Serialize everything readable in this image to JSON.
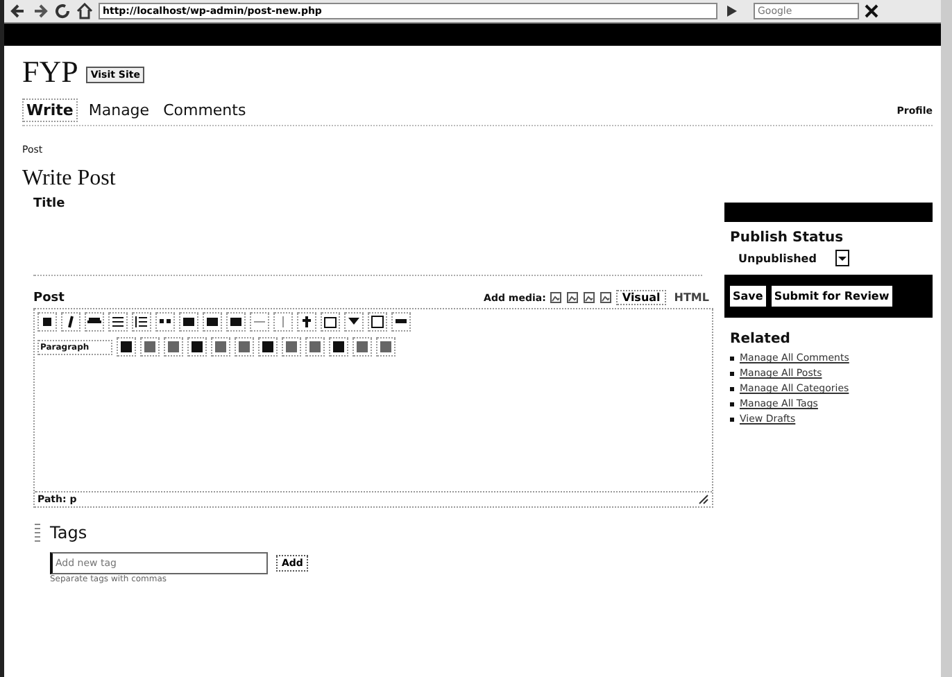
{
  "browser": {
    "url": "http://localhost/wp-admin/post-new.php",
    "search_placeholder": "Google"
  },
  "header": {
    "site_title": "FYP",
    "visit_button": "Visit Site"
  },
  "nav": {
    "items": [
      {
        "label": "Write",
        "selected": true
      },
      {
        "label": "Manage",
        "selected": false
      },
      {
        "label": "Comments",
        "selected": false
      }
    ],
    "profile": "Profile"
  },
  "subnav": {
    "items": [
      {
        "label": "Post",
        "selected": true
      }
    ]
  },
  "page_title": "Write Post",
  "title_field": {
    "label": "Title"
  },
  "editor": {
    "label": "Post",
    "add_media": "Add media:",
    "modes": [
      {
        "label": "Visual",
        "selected": true
      },
      {
        "label": "HTML",
        "selected": false
      }
    ],
    "format": "Paragraph",
    "path": "Path: p"
  },
  "tags": {
    "heading": "Tags",
    "placeholder": "Add new tag",
    "button": "Add",
    "hint": "Separate tags with commas"
  },
  "sidebar": {
    "publish_heading": "Publish Status",
    "status": "Unpublished",
    "buttons": [
      "Save",
      "Submit for Review"
    ],
    "related_heading": "Related",
    "related": [
      "Manage All Comments",
      "Manage All Posts",
      "Manage All Categories",
      "Manage All Tags",
      "View Drafts"
    ]
  }
}
